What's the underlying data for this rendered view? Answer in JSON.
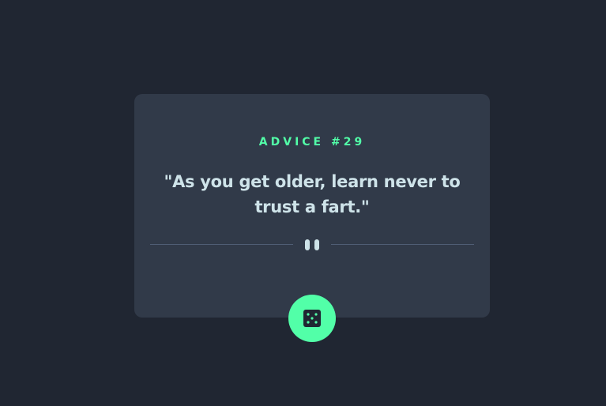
{
  "card": {
    "advice_label": "ADVICE #29",
    "quote": "\"As you get older, learn never to trust a fart.\""
  },
  "divider": {
    "icon": "pause-icon"
  },
  "generate_button": {
    "icon": "dice-icon"
  },
  "colors": {
    "background": "#202632",
    "card": "#313a49",
    "accent": "#52ffa8",
    "text": "#cee3e9",
    "divider": "#4f5d74"
  }
}
